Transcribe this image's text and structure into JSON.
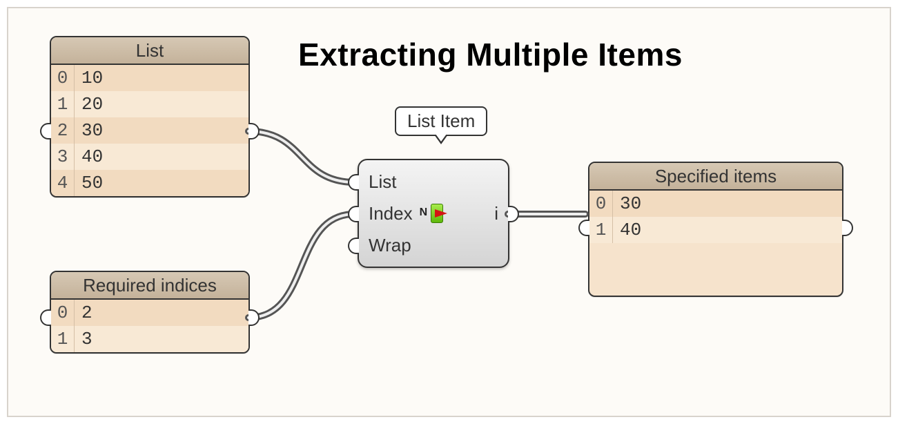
{
  "title": "Extracting Multiple Items",
  "panels": {
    "list": {
      "header": "List",
      "rows": [
        {
          "idx": "0",
          "val": "10"
        },
        {
          "idx": "1",
          "val": "20"
        },
        {
          "idx": "2",
          "val": "30"
        },
        {
          "idx": "3",
          "val": "40"
        },
        {
          "idx": "4",
          "val": "50"
        }
      ]
    },
    "indices": {
      "header": "Required indices",
      "rows": [
        {
          "idx": "0",
          "val": "2"
        },
        {
          "idx": "1",
          "val": "3"
        }
      ]
    },
    "output": {
      "header": "Specified items",
      "rows": [
        {
          "idx": "0",
          "val": "30"
        },
        {
          "idx": "1",
          "val": "40"
        }
      ]
    }
  },
  "component": {
    "tooltip": "List Item",
    "inputs": {
      "list": "List",
      "index": "Index",
      "wrap": "Wrap"
    },
    "icon_letter": "N",
    "output_label": "i"
  }
}
